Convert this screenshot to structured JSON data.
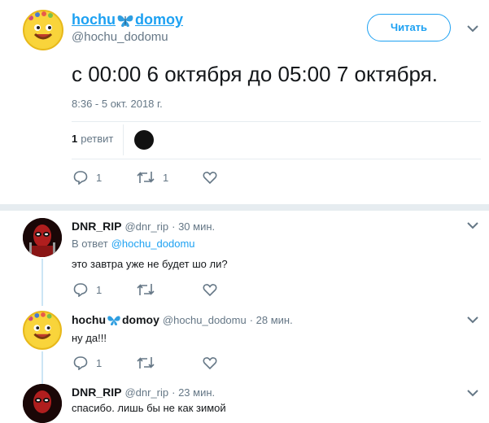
{
  "main_tweet": {
    "author_name": "hochu",
    "author_name_suffix": "domoy",
    "author_handle": "@hochu_dodomu",
    "follow_label": "Читать",
    "text": "с 00:00 6 октября до 05:00 7 октября.",
    "timestamp": "8:36 - 5 окт. 2018 г.",
    "retweet_count": "1",
    "retweet_label": "ретвит",
    "actions": {
      "reply_count": "1",
      "retweet_count": "1"
    }
  },
  "replies": [
    {
      "author_name": "DNR_RIP",
      "author_handle": "@dnr_rip",
      "time": "· 30 мин.",
      "reply_to_label": "В ответ",
      "reply_to_handle": "@hochu_dodomu",
      "text": "это завтра уже не будет шо ли?",
      "reply_count": "1"
    },
    {
      "author_name": "hochu",
      "author_name_suffix": "domoy",
      "author_handle": "@hochu_dodomu",
      "time": "· 28 мин.",
      "text": "ну да!!!",
      "reply_count": "1"
    },
    {
      "author_name": "DNR_RIP",
      "author_handle": "@dnr_rip",
      "time": "· 23 мин.",
      "text": "спасибо. лишь бы не как зимой"
    }
  ],
  "colors": {
    "accent": "#1da1f2",
    "muted": "#657786",
    "divider": "#e6ecf0",
    "thread": "#cce5f5"
  },
  "icons": [
    "butterfly-icon",
    "chevron-down-icon",
    "reply-icon",
    "retweet-icon",
    "like-icon"
  ]
}
